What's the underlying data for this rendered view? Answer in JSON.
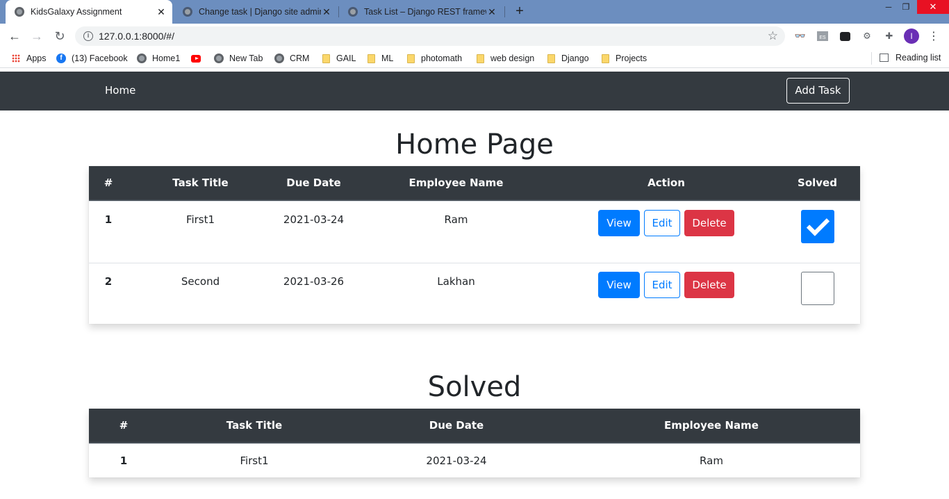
{
  "browser": {
    "tabs": [
      {
        "title": "KidsGalaxy Assignment",
        "active": true
      },
      {
        "title": "Change task | Django site admin",
        "active": false
      },
      {
        "title": "Task List – Django REST framewo",
        "active": false
      }
    ],
    "url": "127.0.0.1:8000/#/",
    "avatar_letter": "I",
    "bookmarks": [
      {
        "label": "Apps",
        "icon": "apps-grid-icon"
      },
      {
        "label": "(13) Facebook",
        "icon": "facebook-icon"
      },
      {
        "label": "Home1",
        "icon": "globe-icon"
      },
      {
        "label": "",
        "icon": "youtube-icon"
      },
      {
        "label": "New Tab",
        "icon": "globe-icon"
      },
      {
        "label": "CRM",
        "icon": "globe-icon"
      },
      {
        "label": "GAIL",
        "icon": "folder-icon"
      },
      {
        "label": "ML",
        "icon": "folder-icon"
      },
      {
        "label": "photomath",
        "icon": "folder-icon"
      },
      {
        "label": "web design",
        "icon": "folder-icon"
      },
      {
        "label": "Django",
        "icon": "folder-icon"
      },
      {
        "label": "Projects",
        "icon": "folder-icon"
      }
    ],
    "reading_list": "Reading list"
  },
  "navbar": {
    "brand": "Home",
    "add_task": "Add Task"
  },
  "home": {
    "title": "Home Page",
    "headers": [
      "#",
      "Task Title",
      "Due Date",
      "Employee Name",
      "Action",
      "Solved"
    ],
    "rows": [
      {
        "num": "1",
        "title": "First1",
        "due": "2021-03-24",
        "employee": "Ram",
        "solved": true
      },
      {
        "num": "2",
        "title": "Second",
        "due": "2021-03-26",
        "employee": "Lakhan",
        "solved": false
      }
    ],
    "actions": {
      "view": "View",
      "edit": "Edit",
      "delete": "Delete"
    }
  },
  "solved": {
    "title": "Solved",
    "headers": [
      "#",
      "Task Title",
      "Due Date",
      "Employee Name"
    ],
    "rows": [
      {
        "num": "1",
        "title": "First1",
        "due": "2021-03-24",
        "employee": "Ram"
      }
    ]
  },
  "colors": {
    "navbar": "#343a40",
    "primary": "#007bff",
    "danger": "#dc3545",
    "tabstrip": "#6c8ebf"
  }
}
